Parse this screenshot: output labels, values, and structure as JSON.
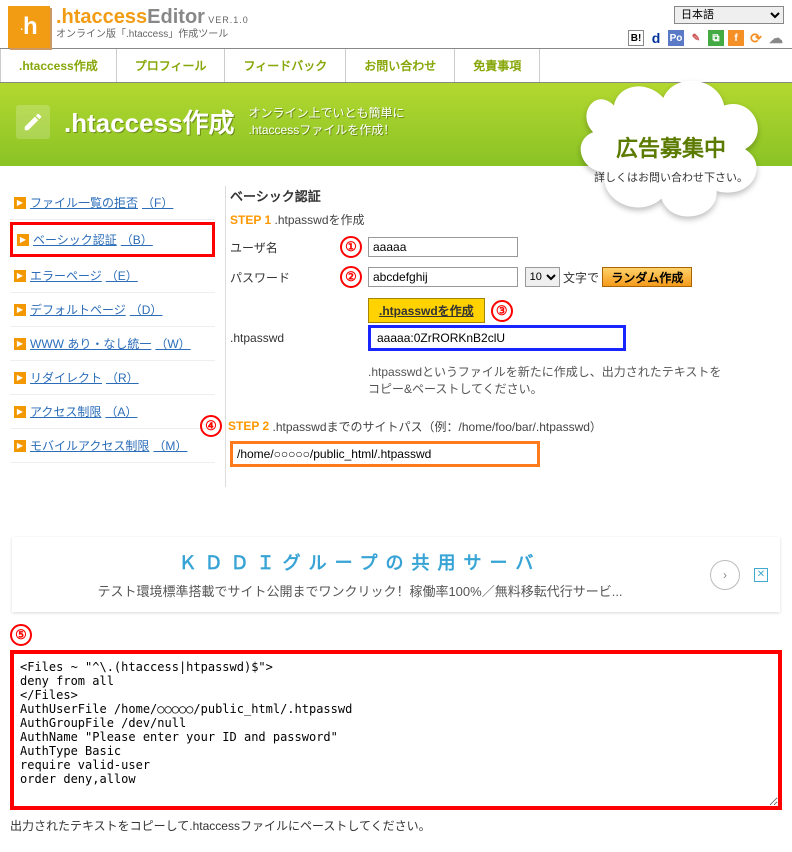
{
  "header": {
    "logo_dot": ".",
    "logo_h": "h",
    "logo_htaccess": ".htaccess",
    "logo_editor": "Editor",
    "logo_ver": "VER.1.0",
    "logo_sub": "オンライン版「.htaccess」作成ツール",
    "language_value": "日本語"
  },
  "share_icons": [
    "B!",
    "d",
    "Po",
    "✎",
    "⧉",
    "f",
    "⟳",
    "☁"
  ],
  "nav": [
    ".htaccess作成",
    "プロフィール",
    "フィードバック",
    "お問い合わせ",
    "免責事項"
  ],
  "banner": {
    "title": ".htaccess作成",
    "sub1": "オンライン上でいとも簡単に",
    "sub2": ".htaccessファイルを作成！"
  },
  "ad_cloud": {
    "title": "広告募集中",
    "sub": "詳しくはお問い合わせ下さい。"
  },
  "sidebar": [
    {
      "label": "ファイル一覧の拒否",
      "hotkey": "（F）"
    },
    {
      "label": "ベーシック認証",
      "hotkey": "（B）",
      "selected": true
    },
    {
      "label": "エラーページ",
      "hotkey": "（E）"
    },
    {
      "label": "デフォルトページ",
      "hotkey": "（D）"
    },
    {
      "label": "WWW あり・なし統一",
      "hotkey": "（W）"
    },
    {
      "label": "リダイレクト",
      "hotkey": "（R）"
    },
    {
      "label": "アクセス制限",
      "hotkey": "（A）"
    },
    {
      "label": "モバイルアクセス制限",
      "hotkey": "（M）"
    }
  ],
  "form": {
    "section_title": "ベーシック認証",
    "step1_label": "STEP 1",
    "step1_desc": ".htpasswdを作成",
    "user_label": "ユーザ名",
    "user_value": "aaaaa",
    "pass_label": "パスワード",
    "pass_value": "abcdefghij",
    "len_value": "10",
    "len_suffix": "文字で",
    "rand_btn": "ランダム作成",
    "gen_btn": ".htpasswdを作成",
    "htpasswd_label": ".htpasswd",
    "htpasswd_value": "aaaaa:0ZrRORKnB2clU",
    "htpasswd_hint": ".htpasswdというファイルを新たに作成し、出力されたテキストをコピー&ペーストしてください。",
    "step2_label": "STEP 2",
    "step2_desc": ".htpasswdまでのサイトパス（例：/home/foo/bar/.htpasswd）",
    "step2_value": "/home/○○○○○/public_html/.htpasswd"
  },
  "circles": {
    "c1": "①",
    "c2": "②",
    "c3": "③",
    "c4": "④",
    "c5": "⑤"
  },
  "ad_row": {
    "title": "ＫＤＤＩグループの共用サーバ",
    "desc": "テスト環境標準搭載でサイト公開までワンクリック！稼働率100%／無料移転代行サービ..."
  },
  "output": {
    "text": "<Files ~ \"^\\.(htaccess|htpasswd)$\">\ndeny from all\n</Files>\nAuthUserFile /home/○○○○○/public_html/.htpasswd\nAuthGroupFile /dev/null\nAuthName \"Please enter your ID and password\"\nAuthType Basic\nrequire valid-user\norder deny,allow",
    "note": "出力されたテキストをコピーして.htaccessファイルにペーストしてください。"
  }
}
